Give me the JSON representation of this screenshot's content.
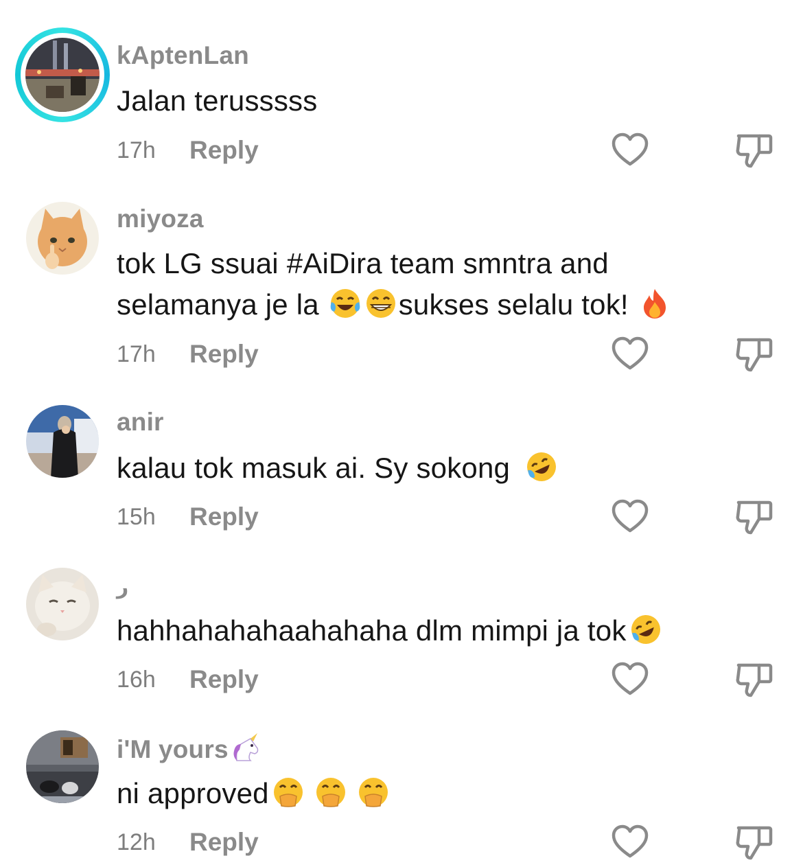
{
  "comments": [
    {
      "username": "kAptenLan",
      "text": "Jalan terusssss",
      "time": "17h",
      "reply": "Reply",
      "avatar_icon": "city-night-photo"
    },
    {
      "username": "miyoza",
      "line1": "tok LG ssuai #AiDira team smntra and",
      "line2a": "selamanya je la",
      "line2b": "sukses selalu tok!",
      "time": "17h",
      "reply": "Reply",
      "avatar_icon": "cat-pointing-photo"
    },
    {
      "username": "anir",
      "text": "kalau tok masuk ai. Sy sokong",
      "time": "15h",
      "reply": "Reply",
      "avatar_icon": "person-hijab-photo"
    },
    {
      "username": "ر",
      "text": "hahhahahahaahahaha dlm mimpi ja tok",
      "time": "16h",
      "reply": "Reply",
      "avatar_icon": "white-cat-photo"
    },
    {
      "username": "i'M yours",
      "text": "ni approved",
      "time": "12h",
      "reply": "Reply",
      "avatar_icon": "room-shoes-photo"
    }
  ],
  "colors": {
    "story_ring": "#23cfe0",
    "muted_text": "#8a8a8a",
    "icon_stroke": "#8a8a8a"
  },
  "emojis": [
    "face-with-tears-of-joy",
    "grinning-face",
    "fire",
    "rolling-on-floor-laughing",
    "unicorn",
    "face-with-hand-over-mouth"
  ]
}
